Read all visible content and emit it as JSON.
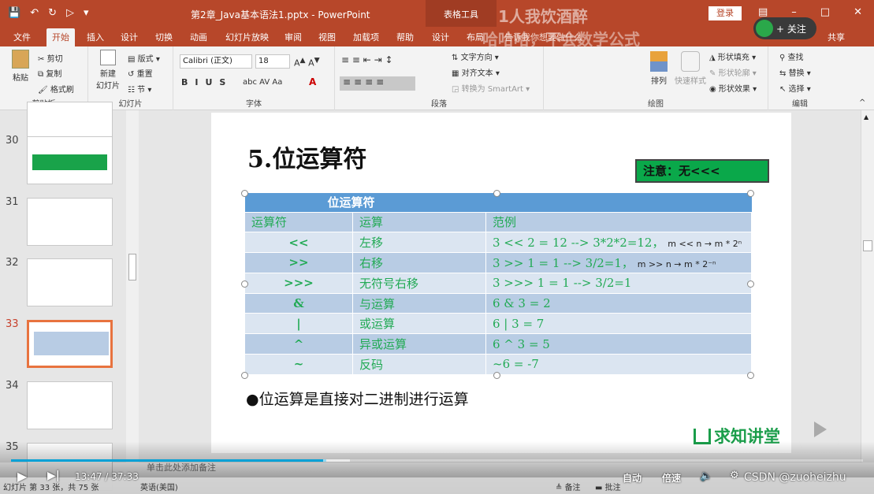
{
  "app": {
    "file_title": "第2章_Java基本语法1.pptx - PowerPoint",
    "context_tab_title": "表格工具",
    "login": "登录",
    "watermark_top": "1人我饮酒醉",
    "watermark_tab": "哈哈哈，不会数学公式"
  },
  "tabs": [
    "文件",
    "开始",
    "插入",
    "设计",
    "切换",
    "动画",
    "幻灯片放映",
    "审阅",
    "视图",
    "加载项",
    "帮助",
    "设计",
    "布局"
  ],
  "tell_me": "告诉我你想要做什么",
  "follow": "+ 关注",
  "share": "共享",
  "ribbon": {
    "clipboard": {
      "label": "剪贴板",
      "paste": "粘贴",
      "cut": "剪切",
      "copy": "复制",
      "painter": "格式刷"
    },
    "slides": {
      "label": "幻灯片",
      "new_slide": "新建\n幻灯片",
      "layout": "版式",
      "reset": "重置",
      "section": "节"
    },
    "font": {
      "label": "字体",
      "font_name": "Calibri (正文)",
      "font_size": "18"
    },
    "paragraph": {
      "label": "段落",
      "text_direction": "文字方向",
      "align_text": "对齐文本",
      "smartart": "转换为 SmartArt"
    },
    "drawing": {
      "label": "绘图",
      "arrange": "排列",
      "quick_styles": "快速样式",
      "fill": "形状填充",
      "outline": "形状轮廓",
      "effects": "形状效果"
    },
    "editing": {
      "label": "编辑",
      "find": "查找",
      "replace": "替换",
      "select": "选择"
    }
  },
  "thumbnails": [
    {
      "num": "30"
    },
    {
      "num": "31"
    },
    {
      "num": "32"
    },
    {
      "num": "33",
      "selected": true
    },
    {
      "num": "34"
    },
    {
      "num": "35"
    }
  ],
  "slide": {
    "title": "5.位运算符",
    "note": "注意：无<<<",
    "table": {
      "caption": "位运算符",
      "headers": [
        "运算符",
        "运算",
        "范例"
      ],
      "rows": [
        {
          "op": "<<",
          "name": "左移",
          "example": "3 << 2 = 12 --> 3*2*2=12，",
          "extra": "m << n → m * 2ⁿ"
        },
        {
          "op": ">>",
          "name": "右移",
          "example": "3 >> 1 = 1  --> 3/2=1，",
          "extra": "m >> n → m * 2⁻ⁿ"
        },
        {
          "op": ">>>",
          "name": "无符号右移",
          "example": "3 >>> 1 = 1 --> 3/2=1",
          "extra": ""
        },
        {
          "op": "&",
          "name": "与运算",
          "example": "6 & 3 = 2",
          "extra": ""
        },
        {
          "op": "|",
          "name": "或运算",
          "example": "6 | 3 = 7",
          "extra": ""
        },
        {
          "op": "^",
          "name": "异或运算",
          "example": "6 ^ 3 = 5",
          "extra": ""
        },
        {
          "op": "~",
          "name": "反码",
          "example": "~6 = -7",
          "extra": ""
        }
      ]
    },
    "bullet": "●位运算是直接对二进制进行运算",
    "logo": "求知讲堂"
  },
  "notes_placeholder": "单击此处添加备注",
  "status": {
    "slide_info": "幻灯片 第 33 张，共 75 张",
    "language": "英语(美国)",
    "notes": "备注",
    "comments": "批注"
  },
  "player": {
    "time": "13:47 / 37:33",
    "auto": "自动",
    "speed": "倍速",
    "watermark": "CSDN @zuoheizhu",
    "progress_percent": 37
  }
}
